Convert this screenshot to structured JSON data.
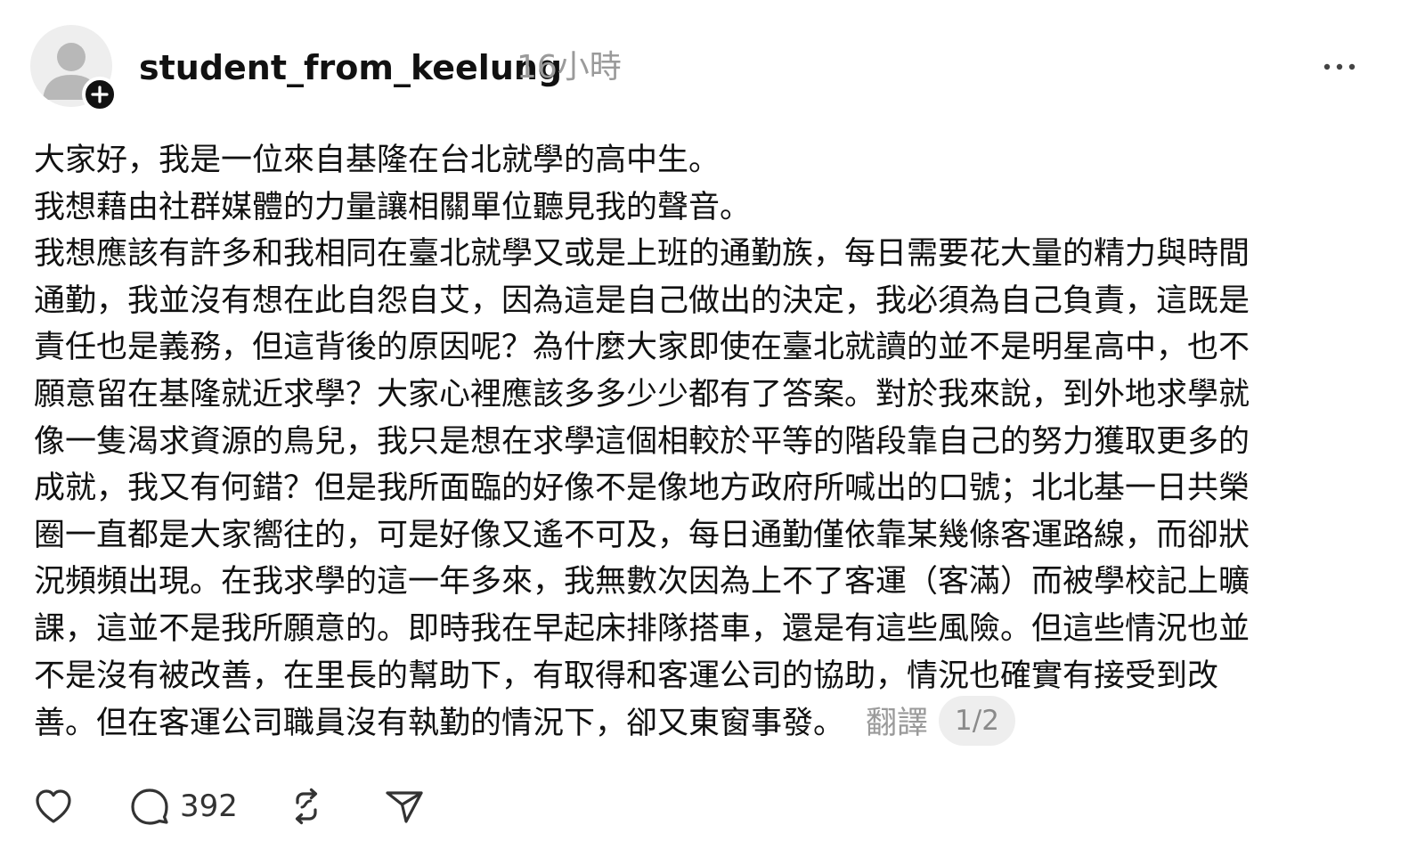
{
  "post": {
    "username": "student_from_keelung",
    "timestamp": "16小時",
    "lines": [
      "大家好，我是一位來自基隆在台北就學的高中生。",
      "我想藉由社群媒體的力量讓相關單位聽見我的聲音。",
      "我想應該有許多和我相同在臺北就學又或是上班的通勤族，每日需要花大量的精力與時間",
      "通勤，我並沒有想在此自怨自艾，因為這是自己做出的決定，我必須為自己負責，這既是",
      "責任也是義務，但這背後的原因呢？為什麼大家即使在臺北就讀的並不是明星高中，也不",
      "願意留在基隆就近求學？大家心裡應該多多少少都有了答案。對於我來說，到外地求學就",
      "像一隻渴求資源的鳥兒，我只是想在求學這個相較於平等的階段靠自己的努力獲取更多的",
      "成就，我又有何錯？但是我所面臨的好像不是像地方政府所喊出的口號；北北基一日共榮",
      "圈一直都是大家嚮往的，可是好像又遙不可及，每日通勤僅依靠某幾條客運路線，而卻狀",
      "況頻頻出現。在我求學的這一年多來，我無數次因為上不了客運（客滿）而被學校記上曠",
      "課，這並不是我所願意的。即時我在早起床排隊搭車，還是有這些風險。但這些情況也並",
      "不是沒有被改善，在里長的幫助下，有取得和客運公司的協助，情況也確實有接受到改",
      "善。但在客運公司職員沒有執勤的情況下，卻又東窗事發。"
    ],
    "translate_label": "翻譯",
    "page_indicator": "1/2"
  },
  "actions": {
    "comment_count": "392"
  },
  "icons": {
    "avatar": "default-user-icon",
    "follow": "plus-icon",
    "more": "more-dots-icon",
    "like": "heart-icon",
    "comment": "comment-bubble-icon",
    "repost": "repost-icon",
    "share": "send-icon"
  }
}
